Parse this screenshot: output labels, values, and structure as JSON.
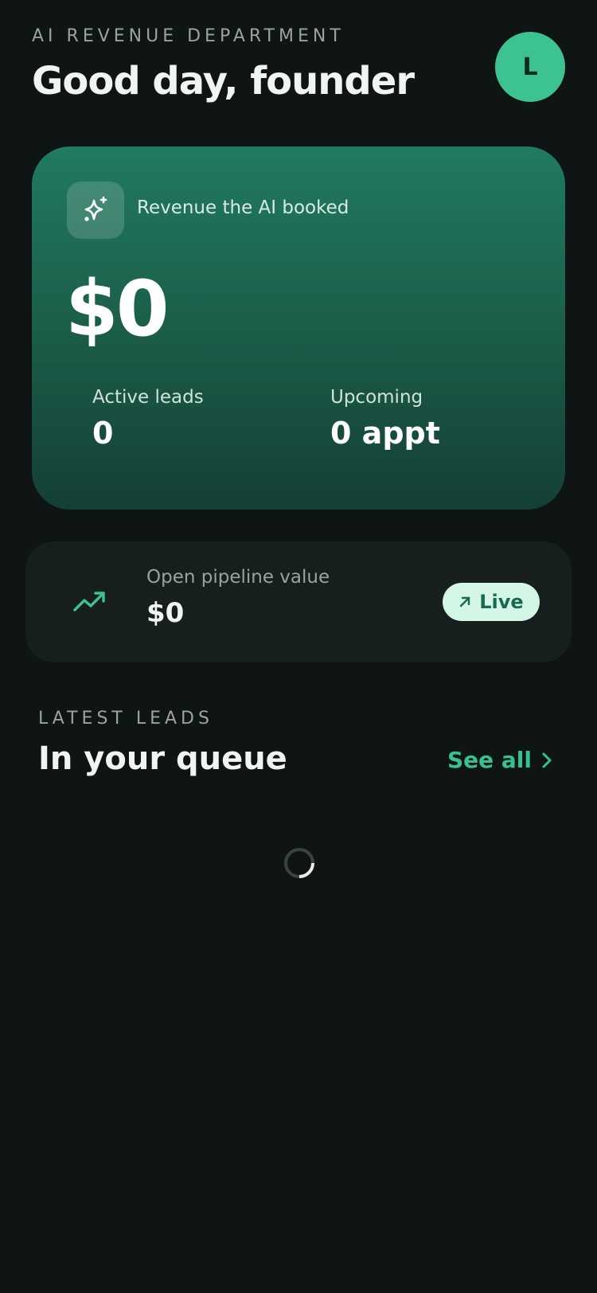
{
  "header": {
    "eyebrow": "AI REVENUE DEPARTMENT",
    "greeting": "Good day, founder",
    "avatar_initial": "L"
  },
  "revenue_card": {
    "icon": "sparkle-icon",
    "label": "Revenue the AI booked",
    "amount": "$0",
    "stats": [
      {
        "label": "Active leads",
        "value": "0"
      },
      {
        "label": "Upcoming",
        "value": "0 appt"
      }
    ]
  },
  "pipeline_card": {
    "icon": "trending-up-icon",
    "label": "Open pipeline value",
    "value": "$0",
    "badge": {
      "icon": "arrow-up-right-icon",
      "label": "Live"
    }
  },
  "leads_section": {
    "eyebrow": "LATEST LEADS",
    "title": "In your queue",
    "see_all_label": "See all",
    "see_all_icon": "chevron-right-icon",
    "loading_indicator": "spinner-icon"
  },
  "colors": {
    "background": "#0e1514",
    "accent": "#3cc391",
    "card_gradient_top": "#217a60",
    "card_gradient_bottom": "#143f34",
    "badge_bg": "#d4f6e6"
  }
}
